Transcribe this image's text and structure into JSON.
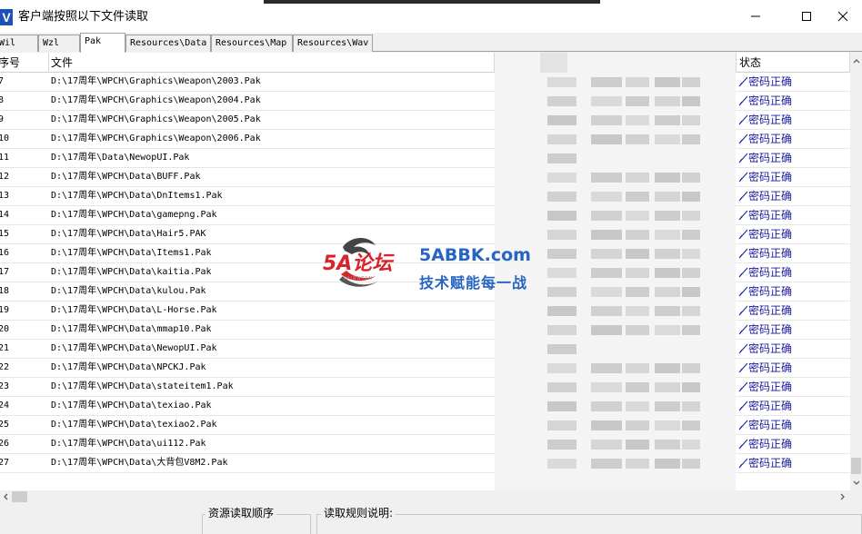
{
  "window": {
    "title": "客户端按照以下文件读取",
    "icon_label": "V"
  },
  "tabs": [
    {
      "label": "Wil",
      "active": false
    },
    {
      "label": "Wzl",
      "active": false
    },
    {
      "label": "Pak",
      "active": true
    },
    {
      "label": "Resources\\Data",
      "active": false
    },
    {
      "label": "Resources\\Map",
      "active": false
    },
    {
      "label": "Resources\\Wav",
      "active": false
    }
  ],
  "list": {
    "columns": {
      "num": "序号",
      "file": "文件",
      "status": "状态"
    },
    "rows": [
      {
        "num": "7",
        "file": "D:\\17周年\\WPCH\\Graphics\\Weapon\\2003.Pak",
        "status": "密码正确"
      },
      {
        "num": "8",
        "file": "D:\\17周年\\WPCH\\Graphics\\Weapon\\2004.Pak",
        "status": "密码正确"
      },
      {
        "num": "9",
        "file": "D:\\17周年\\WPCH\\Graphics\\Weapon\\2005.Pak",
        "status": "密码正确"
      },
      {
        "num": "10",
        "file": "D:\\17周年\\WPCH\\Graphics\\Weapon\\2006.Pak",
        "status": "密码正确"
      },
      {
        "num": "11",
        "file": "D:\\17周年\\Data\\NewopUI.Pak",
        "status": "密码正确"
      },
      {
        "num": "12",
        "file": "D:\\17周年\\WPCH\\Data\\BUFF.Pak",
        "status": "密码正确"
      },
      {
        "num": "13",
        "file": "D:\\17周年\\WPCH\\Data\\DnItems1.Pak",
        "status": "密码正确"
      },
      {
        "num": "14",
        "file": "D:\\17周年\\WPCH\\Data\\gamepng.Pak",
        "status": "密码正确"
      },
      {
        "num": "15",
        "file": "D:\\17周年\\WPCH\\Data\\Hair5.PAK",
        "status": "密码正确"
      },
      {
        "num": "16",
        "file": "D:\\17周年\\WPCH\\Data\\Items1.Pak",
        "status": "密码正确"
      },
      {
        "num": "17",
        "file": "D:\\17周年\\WPCH\\Data\\kaitia.Pak",
        "status": "密码正确"
      },
      {
        "num": "18",
        "file": "D:\\17周年\\WPCH\\Data\\kulou.Pak",
        "status": "密码正确"
      },
      {
        "num": "19",
        "file": "D:\\17周年\\WPCH\\Data\\L-Horse.Pak",
        "status": "密码正确"
      },
      {
        "num": "20",
        "file": "D:\\17周年\\WPCH\\Data\\mmap10.Pak",
        "status": "密码正确"
      },
      {
        "num": "21",
        "file": "D:\\17周年\\WPCH\\Data\\NewopUI.Pak",
        "status": "密码正确"
      },
      {
        "num": "22",
        "file": "D:\\17周年\\WPCH\\Data\\NPCKJ.Pak",
        "status": "密码正确"
      },
      {
        "num": "23",
        "file": "D:\\17周年\\WPCH\\Data\\stateitem1.Pak",
        "status": "密码正确"
      },
      {
        "num": "24",
        "file": "D:\\17周年\\WPCH\\Data\\texiao.Pak",
        "status": "密码正确"
      },
      {
        "num": "25",
        "file": "D:\\17周年\\WPCH\\Data\\texiao2.Pak",
        "status": "密码正确"
      },
      {
        "num": "26",
        "file": "D:\\17周年\\WPCH\\Data\\ui112.Pak",
        "status": "密码正确"
      },
      {
        "num": "27",
        "file": "D:\\17周年\\WPCH\\Data\\大背包V8M2.Pak",
        "status": "密码正确"
      }
    ]
  },
  "watermark": {
    "logo": "5A论坛",
    "site": "5ABBK.com",
    "slogan": "技术赋能每一战",
    "sub": "SAIBNTAN"
  },
  "bottom": {
    "order_label": "资源读取顺序",
    "rules_label": "读取规则说明:"
  },
  "colors": {
    "status_text": "#1a1a9a",
    "watermark_red": "#d8232a",
    "watermark_blue": "#2565c4",
    "app_icon_bg": "#1c52b8"
  }
}
